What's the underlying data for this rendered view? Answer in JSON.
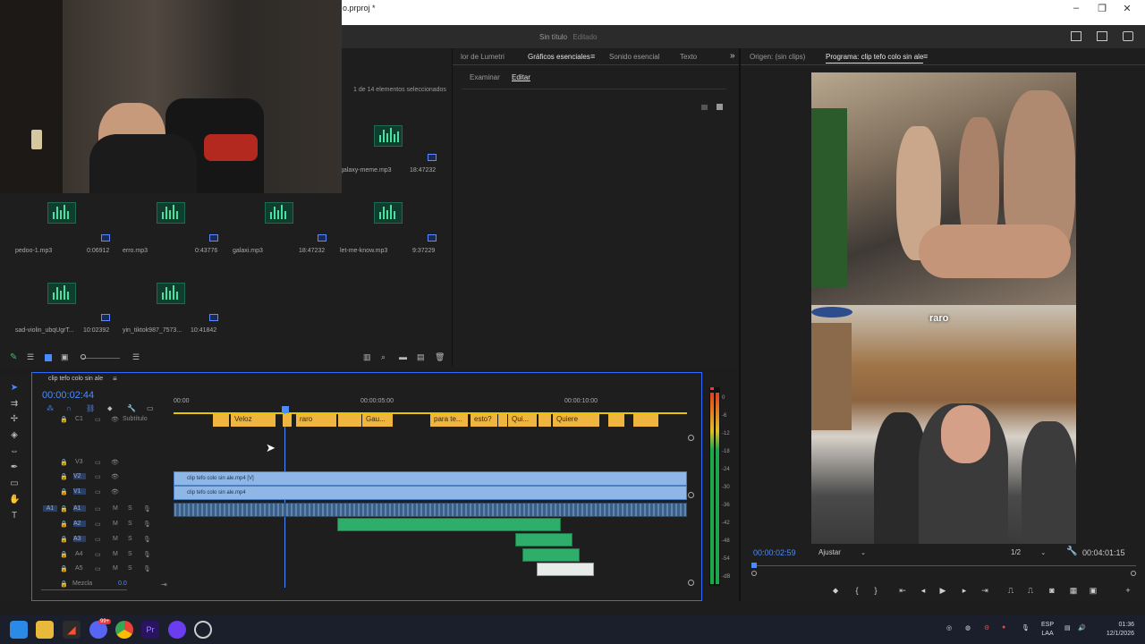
{
  "window": {
    "title": "o.prproj *",
    "document_title": "Sin título",
    "document_status": "Editado"
  },
  "project": {
    "selection_status": "1 de 14 elementos seleccionados",
    "items": [
      {
        "name": "galaxy-meme.mp3",
        "duration": "18:47232"
      },
      {
        "name": "pedoo-1.mp3",
        "duration": "0:06912"
      },
      {
        "name": "erro.mp3",
        "duration": "0:43776"
      },
      {
        "name": "galaxi.mp3",
        "duration": "18:47232"
      },
      {
        "name": "let-me-know.mp3",
        "duration": "9:37229"
      },
      {
        "name": "sad-violin_ubqUgrT...",
        "duration": "10:02392"
      },
      {
        "name": "yin_tiktok987_7573...",
        "duration": "10:41842"
      }
    ]
  },
  "effects_panel": {
    "tabs": [
      "lor de Lumetri",
      "Gráficos esenciales",
      "Sonido esencial",
      "Texto"
    ],
    "subtabs": [
      "Examinar",
      "Editar"
    ]
  },
  "program_monitor": {
    "tabs": [
      "Origen: (sin clips)",
      "Programa: clip tefo colo sin ale"
    ],
    "timecode": "00:00:02:59",
    "fit": "Ajustar",
    "quality": "1/2",
    "duration": "00:04:01:15",
    "overlay_caption": "raro"
  },
  "timeline": {
    "sequence_name": "clip tefo colo sin ale",
    "timecode": "00:00:02:44",
    "ruler": [
      "00:00",
      "00:00:05:00",
      "00:00:10:00"
    ],
    "caption_track": "Subtítulo",
    "captions": [
      "Veloz",
      "raro",
      "Gau...",
      "para te...",
      "esto?",
      "Qui...",
      "Quiere"
    ],
    "video_tracks": [
      "V3",
      "V2",
      "V1"
    ],
    "audio_tracks": [
      "A1",
      "A2",
      "A3",
      "A4",
      "A5"
    ],
    "clips": {
      "v2": "clip tefo colo sin ale.mp4 [V]",
      "v1": "clip tefo colo sin ale.mp4"
    },
    "mix_label": "Mezcla",
    "mix_value": "0.0",
    "track_letters": {
      "mute": "M",
      "solo": "S",
      "c1": "C1",
      "a1_src": "A1"
    }
  },
  "meter_scale": [
    "0",
    "-6",
    "-12",
    "-18",
    "-24",
    "-30",
    "-36",
    "-42",
    "-48",
    "-54",
    "-dB"
  ],
  "taskbar": {
    "language": "ESP",
    "layout": "LAA",
    "time": "01:36",
    "date": "12/1/2026",
    "badge": "99+"
  },
  "colors": {
    "accent": "#2d6cff",
    "caption": "#f0b53f",
    "video_clip": "#8eb6e6",
    "audio_clip": "#2fae6b",
    "timecode": "#4a8cff"
  }
}
